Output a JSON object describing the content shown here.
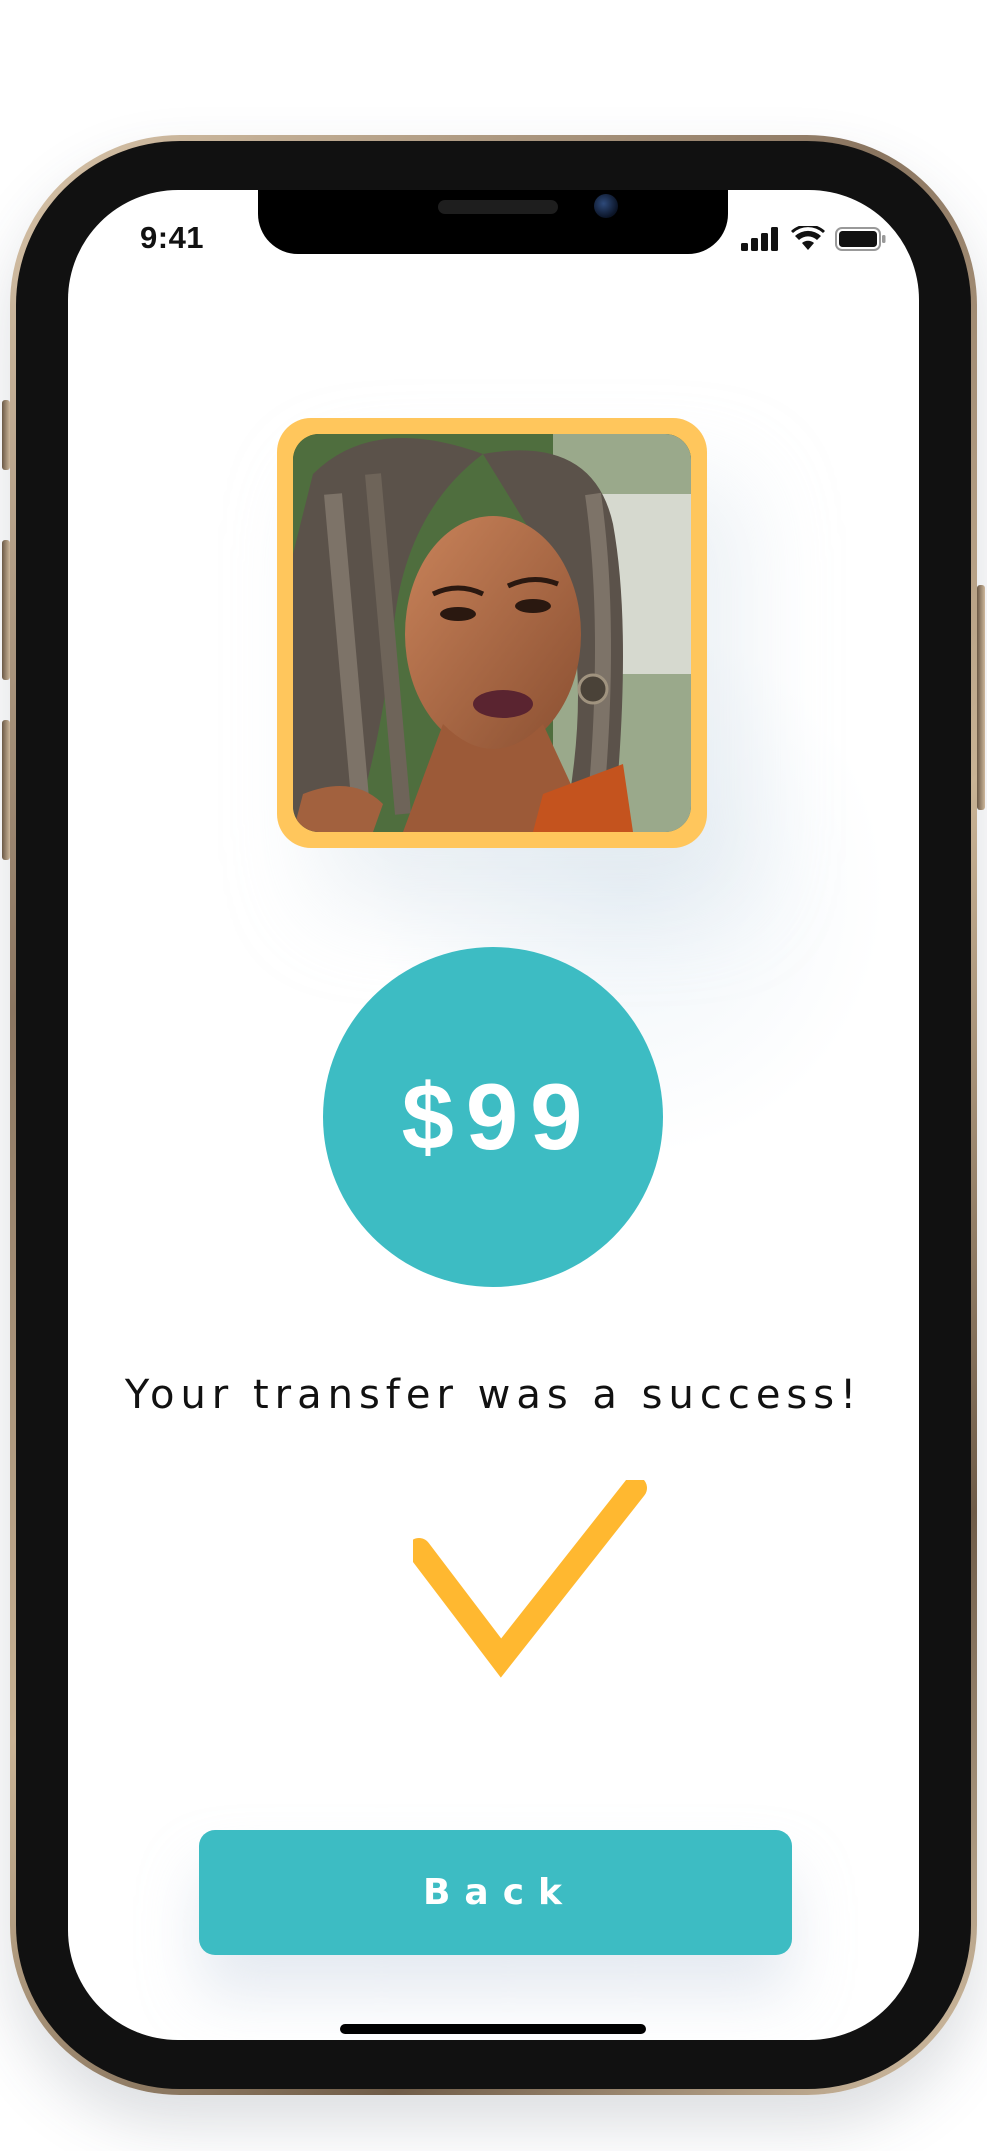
{
  "status_bar": {
    "time": "9:41",
    "icons": [
      "cellular-signal-icon",
      "wifi-icon",
      "battery-icon"
    ]
  },
  "profile": {
    "photo": "profile-photo-woman-braids",
    "frame_color": "#ffc65c"
  },
  "transfer": {
    "amount": "$99",
    "message": "Your transfer was a success!",
    "status_icon": "checkmark-icon"
  },
  "actions": {
    "back_label": "Back"
  },
  "colors": {
    "accent": "#3dbcc3",
    "highlight": "#ffc65c",
    "check": "#ffb830"
  }
}
